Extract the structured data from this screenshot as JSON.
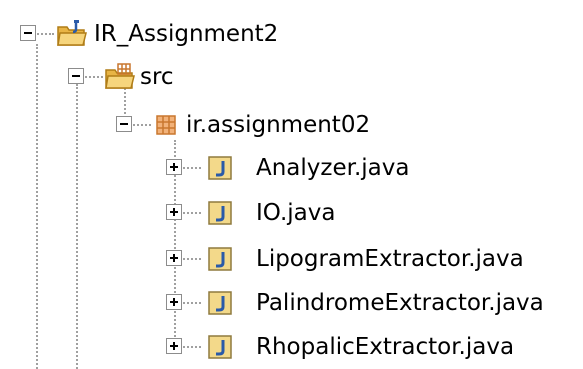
{
  "tree": {
    "project": {
      "label": "IR_Assignment2",
      "icon": "project-folder-icon"
    },
    "source_folder": {
      "label": "src",
      "icon": "source-folder-icon"
    },
    "package": {
      "label": "ir.assignment02",
      "icon": "package-icon"
    },
    "files": [
      {
        "label": "Analyzer.java",
        "icon": "java-file-icon"
      },
      {
        "label": "IO.java",
        "icon": "java-file-icon"
      },
      {
        "label": "LipogramExtractor.java",
        "icon": "java-file-icon"
      },
      {
        "label": "PalindromeExtractor.java",
        "icon": "java-file-icon"
      },
      {
        "label": "RhopalicExtractor.java",
        "icon": "java-file-icon"
      }
    ]
  },
  "colors": {
    "folder": "#e8b445",
    "folder_dark": "#b07d17",
    "java_icon_bg": "#f3d98a",
    "java_letter": "#2a5aa8",
    "package": "#c9772e"
  }
}
